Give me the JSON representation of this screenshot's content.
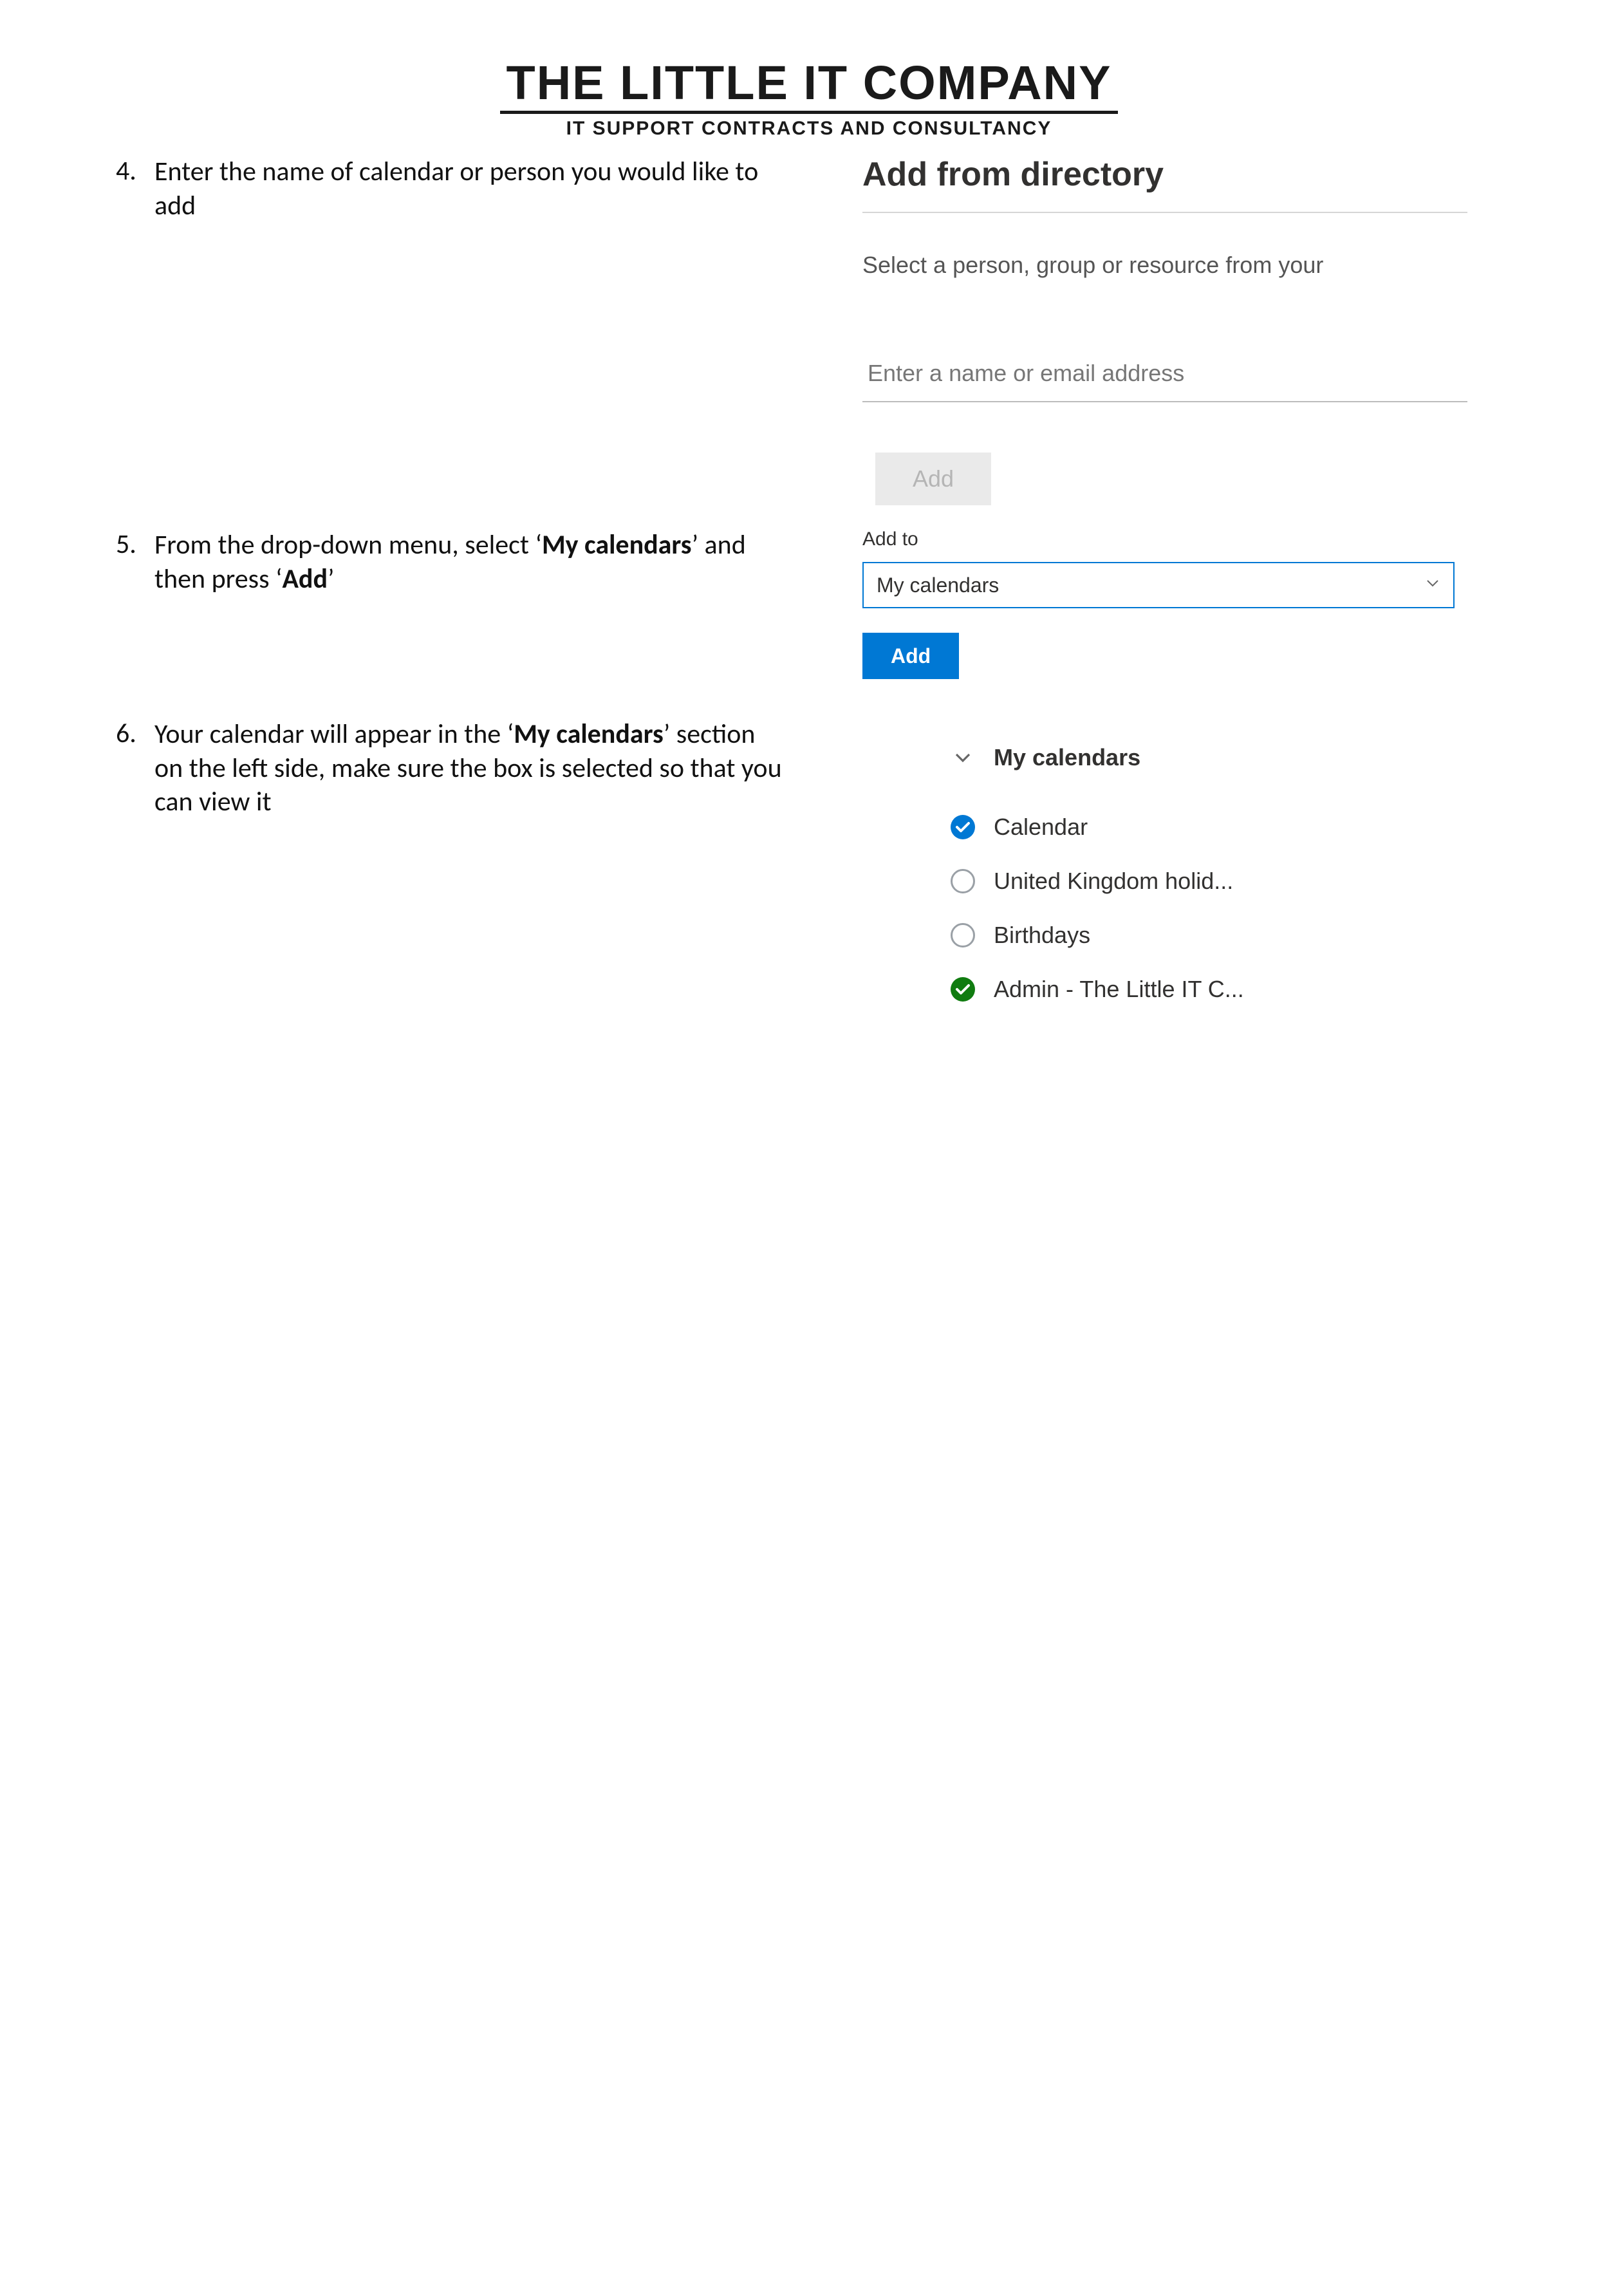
{
  "header": {
    "title": "THE LITTLE IT COMPANY",
    "subtitle": "IT SUPPORT CONTRACTS AND CONSULTANCY"
  },
  "steps": {
    "s4": {
      "num": "4.",
      "text_a": "Enter the name of calendar or person you would like to add"
    },
    "s5": {
      "num": "5.",
      "text_a": "From the drop-down menu, select ‘",
      "bold_a": "My calendars",
      "text_b": "’ and then press ‘",
      "bold_b": "Add",
      "text_c": "’"
    },
    "s6": {
      "num": "6.",
      "text_a": "Your calendar will appear in the ‘",
      "bold_a": "My calendars",
      "text_b": "’ section on the left side, make sure the box is selected so that you can view it"
    }
  },
  "afd": {
    "title": "Add from directory",
    "line": "Select a person, group or resource from your",
    "placeholder": "Enter a name or email address",
    "add_disabled_label": "Add"
  },
  "addto": {
    "label": "Add to",
    "selected": "My calendars",
    "add_btn": "Add"
  },
  "callist": {
    "header": "My calendars",
    "items": [
      {
        "label": "Calendar",
        "checked": true,
        "color": "#0078d4"
      },
      {
        "label": "United Kingdom holid...",
        "checked": false,
        "color": ""
      },
      {
        "label": "Birthdays",
        "checked": false,
        "color": ""
      },
      {
        "label": "Admin - The Little IT C...",
        "checked": true,
        "color": "#107c10"
      }
    ]
  }
}
